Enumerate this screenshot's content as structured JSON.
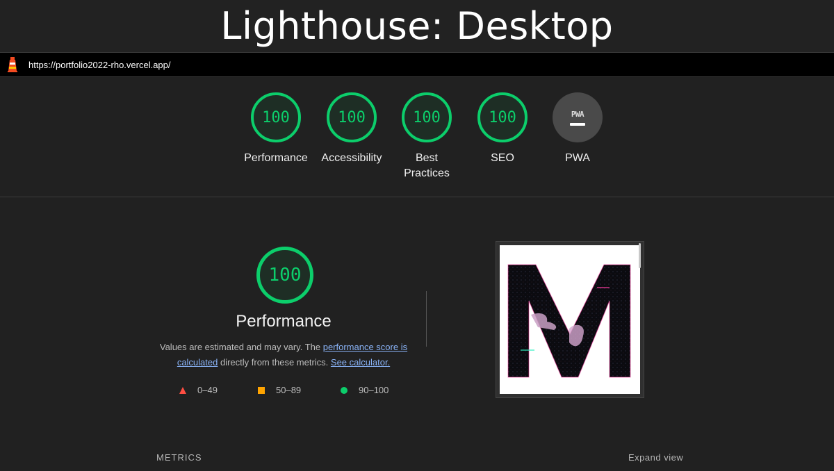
{
  "page_title": "Lighthouse: Desktop",
  "url": "https://portfolio2022-rho.vercel.app/",
  "categories": [
    {
      "score": "100",
      "label": "Performance"
    },
    {
      "score": "100",
      "label": "Accessibility"
    },
    {
      "score": "100",
      "label": "Best Practices"
    },
    {
      "score": "100",
      "label": "SEO"
    },
    {
      "score": "",
      "label": "PWA",
      "badge": "PWA"
    }
  ],
  "performance": {
    "score": "100",
    "title": "Performance",
    "desc_prefix": "Values are estimated and may vary. The ",
    "link_score": "performance score is calculated",
    "desc_middle": " directly from these metrics. ",
    "link_calc": "See calculator.",
    "legend": {
      "fail": "0–49",
      "average": "50–89",
      "pass": "90–100"
    }
  },
  "metrics": {
    "label": "METRICS",
    "expand": "Expand view"
  },
  "colors": {
    "pass": "#0cce6b",
    "average": "#ffa400",
    "fail": "#ff4e42",
    "link": "#8ab4f8"
  }
}
